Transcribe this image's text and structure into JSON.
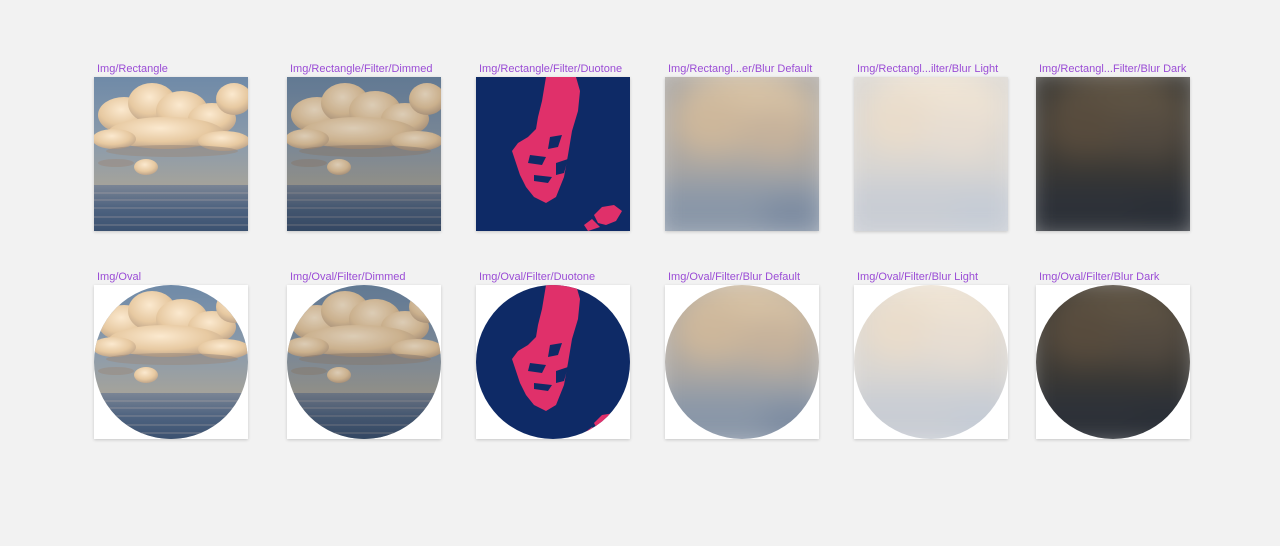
{
  "frames": {
    "rect_plain": {
      "label": "Img/Rectangle"
    },
    "rect_dimmed": {
      "label": "Img/Rectangle/Filter/Dimmed"
    },
    "rect_duotone": {
      "label": "Img/Rectangle/Filter/Duotone"
    },
    "rect_blur_default": {
      "label": "Img/Rectangl...er/Blur Default"
    },
    "rect_blur_light": {
      "label": "Img/Rectangl...ilter/Blur Light"
    },
    "rect_blur_dark": {
      "label": "Img/Rectangl...Filter/Blur Dark"
    },
    "oval_plain": {
      "label": "Img/Oval"
    },
    "oval_dimmed": {
      "label": "Img/Oval/Filter/Dimmed"
    },
    "oval_duotone": {
      "label": "Img/Oval/Filter/Duotone"
    },
    "oval_blur_default": {
      "label": "Img/Oval/Filter/Blur Default"
    },
    "oval_blur_light": {
      "label": "Img/Oval/Filter/Blur Light"
    },
    "oval_blur_dark": {
      "label": "Img/Oval/Filter/Blur Dark"
    }
  },
  "colors": {
    "label": "#9b4dd6",
    "canvas_bg": "#f2f2f2",
    "duotone_dark": "#0e2a66",
    "duotone_light": "#e0306a"
  }
}
